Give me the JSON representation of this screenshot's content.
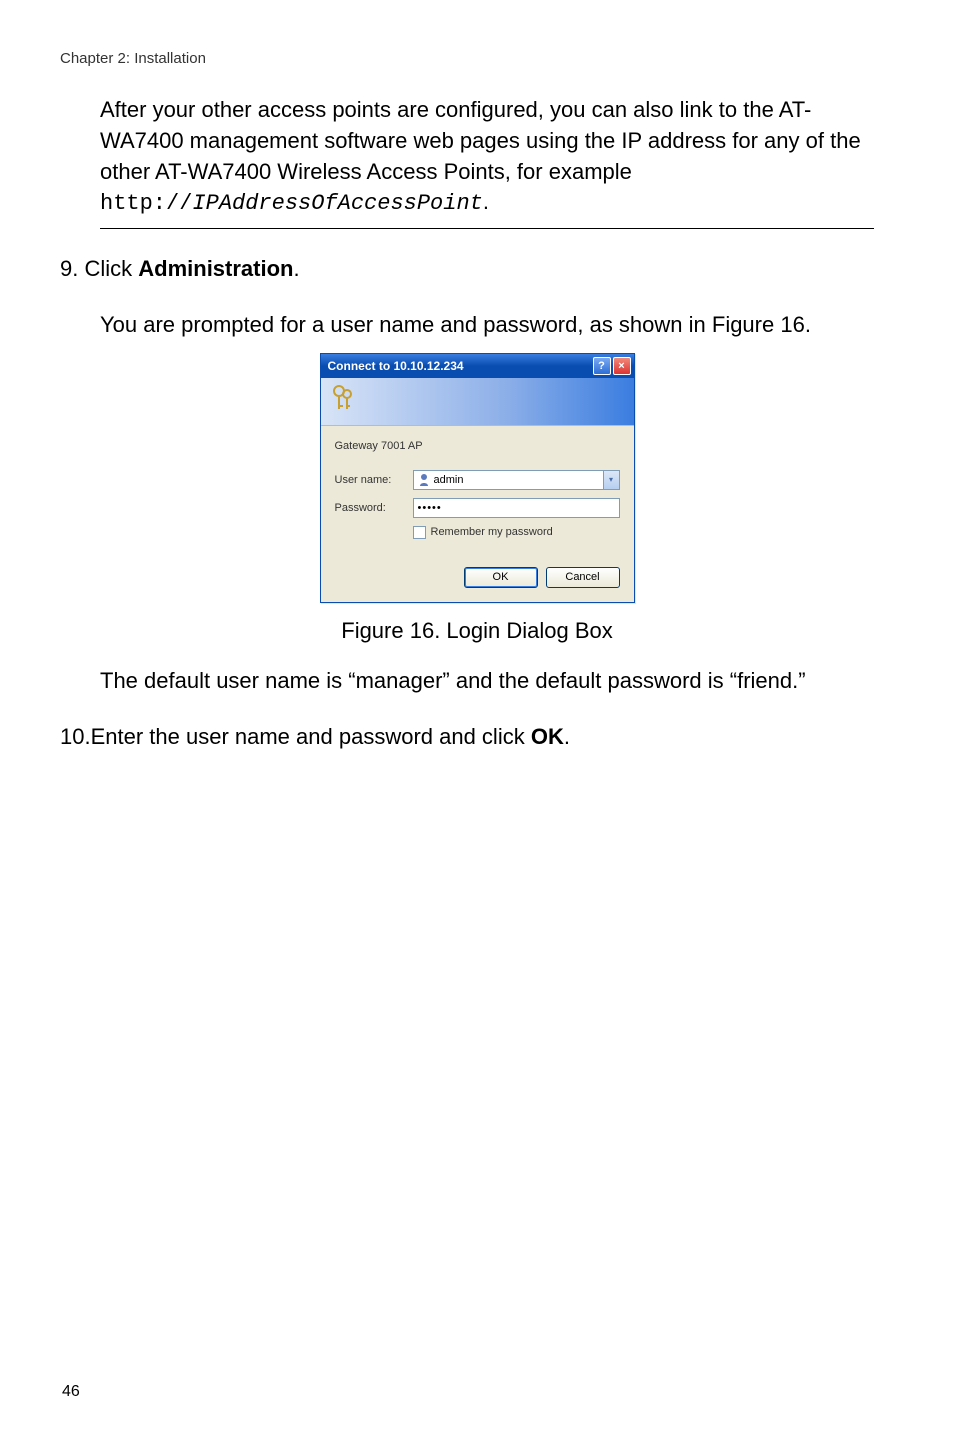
{
  "chapter": "Chapter 2: Installation",
  "intro": {
    "text_before": "After your other access points are configured, you can also link to the AT-WA7400 management software web pages using the IP address for any of the other AT-WA7400 Wireless Access Points, for example ",
    "mono_prefix": "http://",
    "mono_italic": "IPAddressOfAccessPoint",
    "period": "."
  },
  "step9": {
    "prefix": "9. Click ",
    "bold": "Administration",
    "period": "."
  },
  "prompt_para": "You are prompted for a user name and password, as shown in Figure 16.",
  "dialog": {
    "title": "Connect to 10.10.12.234",
    "realm": "Gateway 7001 AP",
    "username_label": "User name:",
    "username_value": "admin",
    "password_label": "Password:",
    "password_value": "•••••",
    "remember": "Remember my password",
    "ok": "OK",
    "cancel": "Cancel"
  },
  "figure_caption": "Figure 16. Login Dialog Box",
  "defaults": "The default user name is “manager” and the default password is “friend.”",
  "step10": {
    "prefix": "10.Enter the user name and password and click ",
    "bold": "OK",
    "period": "."
  },
  "page_number": "46"
}
